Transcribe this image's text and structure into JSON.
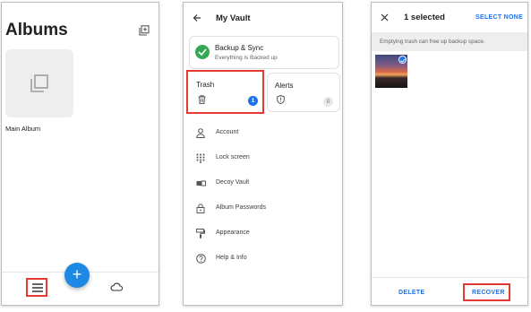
{
  "albums_screen": {
    "title": "Albums",
    "add_icon": "add-album-icon",
    "album": {
      "name": "Main Album",
      "thumb_icon": "album-placeholder-icon"
    },
    "bottom_nav": {
      "menu_icon": "hamburger-menu-icon",
      "fab_label": "+",
      "cloud_icon": "cloud-icon"
    }
  },
  "vault_screen": {
    "title": "My Vault",
    "backup": {
      "title": "Backup & Sync",
      "status": "Everything is Backed up"
    },
    "trash": {
      "label": "Trash",
      "count": "1"
    },
    "alerts": {
      "label": "Alerts",
      "count": "0"
    },
    "menu": [
      {
        "label": "Account",
        "icon": "person-icon"
      },
      {
        "label": "Lock screen",
        "icon": "keypad-icon"
      },
      {
        "label": "Decoy Vault",
        "icon": "decoy-icon"
      },
      {
        "label": "Album Passwords",
        "icon": "lock-icon"
      },
      {
        "label": "Appearance",
        "icon": "paint-roller-icon"
      },
      {
        "label": "Help & Info",
        "icon": "help-icon"
      }
    ]
  },
  "trash_screen": {
    "selected_label": "1 selected",
    "select_none": "SELECT NONE",
    "info": "Emptying trash can free up backup space.",
    "delete": "DELETE",
    "recover": "RECOVER"
  },
  "colors": {
    "accent": "#1a73e8",
    "highlight": "#e53935",
    "success": "#34a853"
  }
}
